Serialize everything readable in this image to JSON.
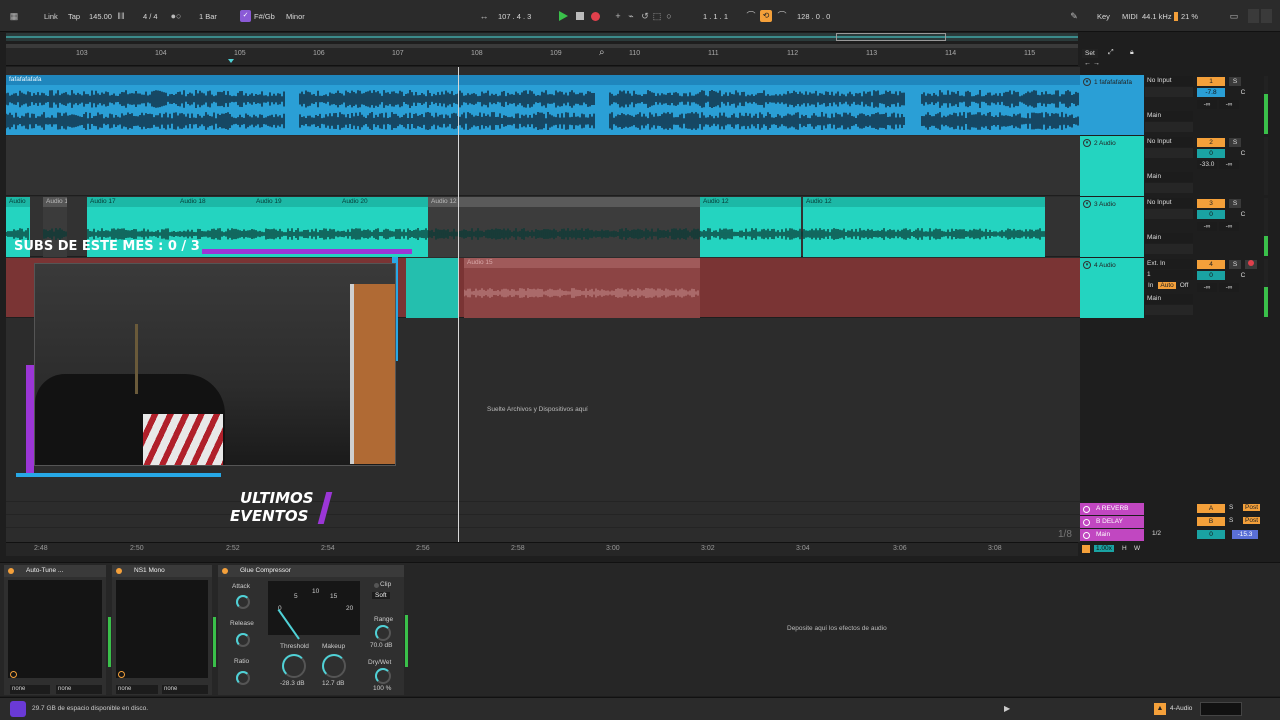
{
  "transport": {
    "link": "Link",
    "tap": "Tap",
    "tempo": "145.00",
    "signature": "4 / 4",
    "quantize": "1 Bar",
    "key": "F#/Gb",
    "scale": "Minor",
    "position": "107 .  4 .  3",
    "loop_start": "1 .  1 .  1",
    "loop_length": "128 .  0 .  0",
    "key_btn": "Key",
    "midi_btn": "MIDI",
    "sample_rate": "44.1 kHz",
    "cpu": "21 %"
  },
  "ruler": {
    "bars": [
      "103",
      "104",
      "105",
      "106",
      "107",
      "108",
      "109",
      "110",
      "111",
      "112",
      "113",
      "114",
      "115"
    ],
    "set_label": "Set"
  },
  "tracks": [
    {
      "name": "1 fafafafafafa",
      "input": "No Input",
      "output": "Main",
      "number": "1",
      "volume": "-7.8",
      "pan": "C",
      "send_a": "-∞",
      "send_b": "-∞",
      "clip_label": "fafafafafafa"
    },
    {
      "name": "2 Audio",
      "input": "No Input",
      "output": "Main",
      "number": "2",
      "volume": "0",
      "pan": "C",
      "send_a": "-33.0",
      "send_b": "-∞"
    },
    {
      "name": "3 Audio",
      "input": "No Input",
      "output": "Main",
      "number": "3",
      "volume": "0",
      "pan": "C",
      "send_a": "-∞",
      "send_b": "-∞",
      "clips": [
        "Audio",
        "Audio 1",
        "Audio 17",
        "Audio 18",
        "Audio 19",
        "Audio 20",
        "Audio 12",
        "Audio 12",
        "Audio 12"
      ]
    },
    {
      "name": "4 Audio",
      "input": "Ext. In",
      "channel": "1",
      "monitor": [
        "In",
        "Auto",
        "Off"
      ],
      "output": "Main",
      "number": "4",
      "volume": "0",
      "pan": "C",
      "send_a": "-∞",
      "send_b": "-∞",
      "clips": [
        "Audio 15"
      ]
    }
  ],
  "returns": [
    {
      "name": "A REVERB",
      "letter": "A",
      "solo": "S",
      "post": "Post"
    },
    {
      "name": "B DELAY",
      "letter": "B",
      "solo": "S",
      "post": "Post"
    },
    {
      "name": "Main",
      "routing": "1/2",
      "volume": "0",
      "pan": "-15.3"
    }
  ],
  "drop_hint": "Suelte Archivos y Dispositivos aquí",
  "zoom_fraction": "1/8",
  "timeline": [
    "2:48",
    "2:50",
    "2:52",
    "2:54",
    "2:56",
    "2:58",
    "3:00",
    "3:02",
    "3:04",
    "3:06",
    "3:08"
  ],
  "tempo_follow": {
    "value": "1.00x",
    "h": "H",
    "w": "W"
  },
  "overlay": {
    "subs": "SUBS DE ESTE MES : 0 / 3",
    "events_line1": "ULTIMOS",
    "events_line2": "EVENTOS"
  },
  "devices": {
    "autotune": {
      "title": "Auto-Tune ...",
      "sel1": "none",
      "sel2": "none"
    },
    "ns1": {
      "title": "NS1 Mono",
      "sel1": "none",
      "sel2": "none"
    },
    "glue": {
      "title": "Glue Compressor",
      "attack_label": "Attack",
      "release_label": "Release",
      "ratio_label": "Ratio",
      "clip_label": "Clip",
      "soft_label": "Soft",
      "threshold_label": "Threshold",
      "threshold_value": "-28.3 dB",
      "makeup_label": "Makeup",
      "makeup_value": "12.7 dB",
      "range_label": "Range",
      "range_value": "70.0 dB",
      "drywet_label": "Dry/Wet",
      "drywet_value": "100 %",
      "scale": [
        "0",
        "5",
        "10",
        "15",
        "20"
      ],
      "threshold_level": 0.35,
      "makeup_level": 0.55
    },
    "drop_hint": "Deposite aquí los efectos de audio"
  },
  "status": {
    "disk": "29.7 GB de espacio disponible en disco.",
    "track": "4-Audio"
  },
  "colors": {
    "track1": "#2a9fd6",
    "track3": "#24d4c0",
    "track4": "#8a3a3a",
    "accent": "#f4a03a",
    "return_pink": "#c147c1"
  }
}
